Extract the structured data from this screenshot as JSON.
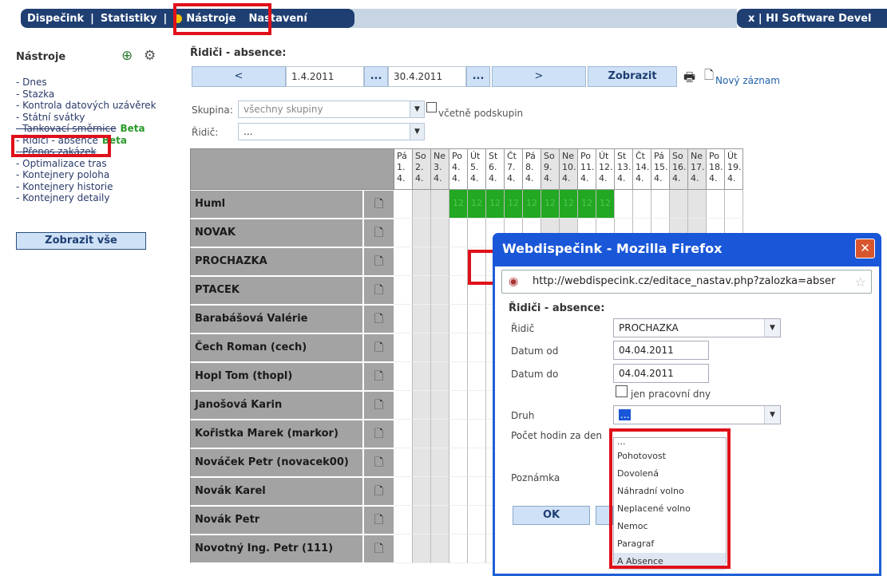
{
  "nav": {
    "items": [
      "Dispečink",
      "Statistiky",
      "Nástroje",
      "Nastavení"
    ],
    "separator": "|",
    "right_text": "x  |  HI Software Devel"
  },
  "sidebar": {
    "title": "Nástroje",
    "items": [
      "- Dnes",
      "- Stazka",
      "- Kontrola datových uzávěrek",
      "- Státní svátky",
      "- Tankovací směrnice",
      "- Řidiči - absence",
      "- Přenos zakázek",
      "- Optimalizace tras",
      "- Kontejnery poloha",
      "- Kontejnery historie",
      "- Kontejnery detaily"
    ],
    "beta_label": "Beta",
    "show_all": "Zobrazit vše"
  },
  "main": {
    "title": "Řidiči - absence:",
    "prev": "<",
    "date_from": "1.4.2011",
    "dots": "...",
    "date_to": "30.4.2011",
    "next": ">",
    "show": "Zobrazit",
    "new_record": "Nový záznam",
    "group_label": "Skupina:",
    "group_value": "všechny skupiny",
    "subgroups_label": "včetně podskupin",
    "driver_label": "Řidič:",
    "driver_value": "..."
  },
  "grid": {
    "days": [
      {
        "d": "Pá",
        "n": "1.",
        "m": "4."
      },
      {
        "d": "So",
        "n": "2.",
        "m": "4."
      },
      {
        "d": "Ne",
        "n": "3.",
        "m": "4."
      },
      {
        "d": "Po",
        "n": "4.",
        "m": "4."
      },
      {
        "d": "Út",
        "n": "5.",
        "m": "4."
      },
      {
        "d": "St",
        "n": "6.",
        "m": "4."
      },
      {
        "d": "Čt",
        "n": "7.",
        "m": "4."
      },
      {
        "d": "Pá",
        "n": "8.",
        "m": "4."
      },
      {
        "d": "So",
        "n": "9.",
        "m": "4."
      },
      {
        "d": "Ne",
        "n": "10.",
        "m": "4."
      },
      {
        "d": "Po",
        "n": "11.",
        "m": "4."
      },
      {
        "d": "Út",
        "n": "12.",
        "m": "4."
      },
      {
        "d": "St",
        "n": "13.",
        "m": "4."
      },
      {
        "d": "Čt",
        "n": "14.",
        "m": "4."
      },
      {
        "d": "Pá",
        "n": "15.",
        "m": "4."
      },
      {
        "d": "So",
        "n": "16.",
        "m": "4."
      },
      {
        "d": "Ne",
        "n": "17.",
        "m": "4."
      },
      {
        "d": "Po",
        "n": "18.",
        "m": "4."
      },
      {
        "d": "Út",
        "n": "19.",
        "m": "4."
      }
    ],
    "drivers": [
      "Huml",
      "NOVAK",
      "PROCHAZKA",
      "PTACEK",
      "Barabášová Valérie",
      "Čech Roman (cech)",
      "Hopl Tom (thopl)",
      "Janošová Karin",
      "Kořistka Marek (markor)",
      "Nováček Petr (novacek00)",
      "Novák Karel",
      "Novák Petr",
      "Novotný Ing. Petr (111)"
    ],
    "huml_hours": "12"
  },
  "popup": {
    "title": "Webdispečink - Mozilla Firefox",
    "url": "http://webdispecink.cz/editace_nastav.php?zalozka=abser",
    "heading": "Řidiči - absence:",
    "driver_label": "Řidič",
    "driver_value": "PROCHAZKA",
    "date_from_label": "Datum od",
    "date_from_value": "04.04.2011",
    "date_to_label": "Datum do",
    "date_to_value": "04.04.2011",
    "workdays_label": "jen pracovní dny",
    "type_label": "Druh",
    "type_value": "...",
    "hours_label": "Počet hodin za den",
    "note_label": "Poznámka",
    "ok": "OK"
  },
  "dropdown": {
    "options": [
      "...",
      "Pohotovost",
      "Dovolená",
      "Náhradní volno",
      "Neplacené volno",
      "Nemoc",
      "Paragraf",
      "A Absence"
    ],
    "selected_index": 7
  },
  "colors": {
    "nav_bg": "#1f3f73",
    "accent_blue": "#1a57d8",
    "highlight_red": "#e0101a",
    "absence_green": "#22a822"
  }
}
